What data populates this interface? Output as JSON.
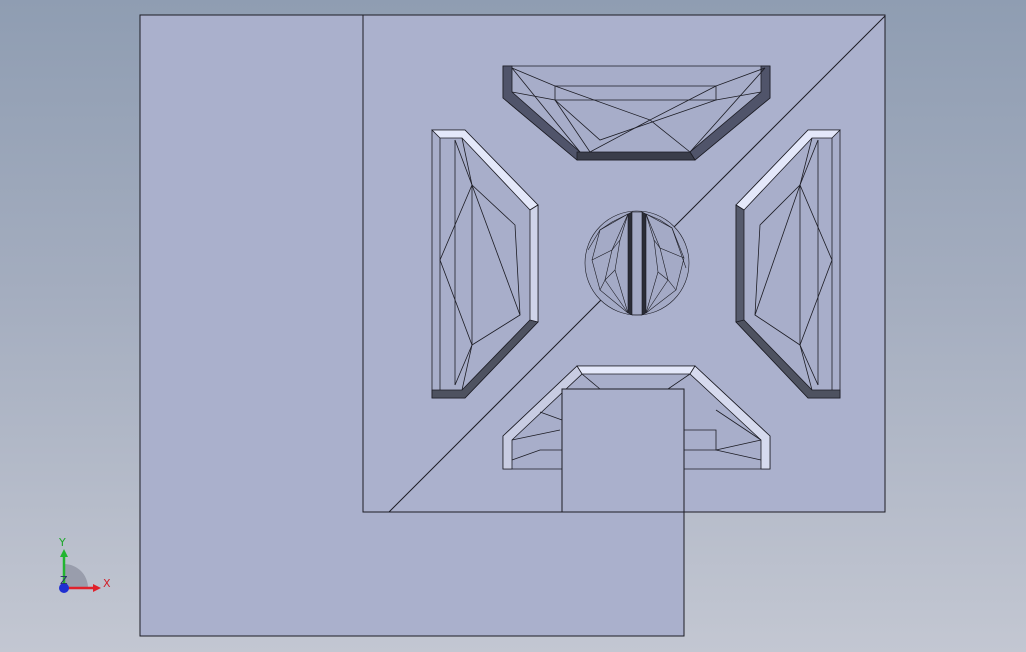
{
  "colors": {
    "face": "#aab0cc",
    "face_light": "#b2b8d2",
    "edge": "#1c1c24",
    "shadow": "#4e5260",
    "bevel_light": "#e4e8fa",
    "x_axis": "#e0212b",
    "y_axis": "#22b531",
    "z_axis": "#1f2fd1"
  },
  "triad": {
    "x_label": "X",
    "y_label": "Y",
    "z_label": "Z"
  }
}
